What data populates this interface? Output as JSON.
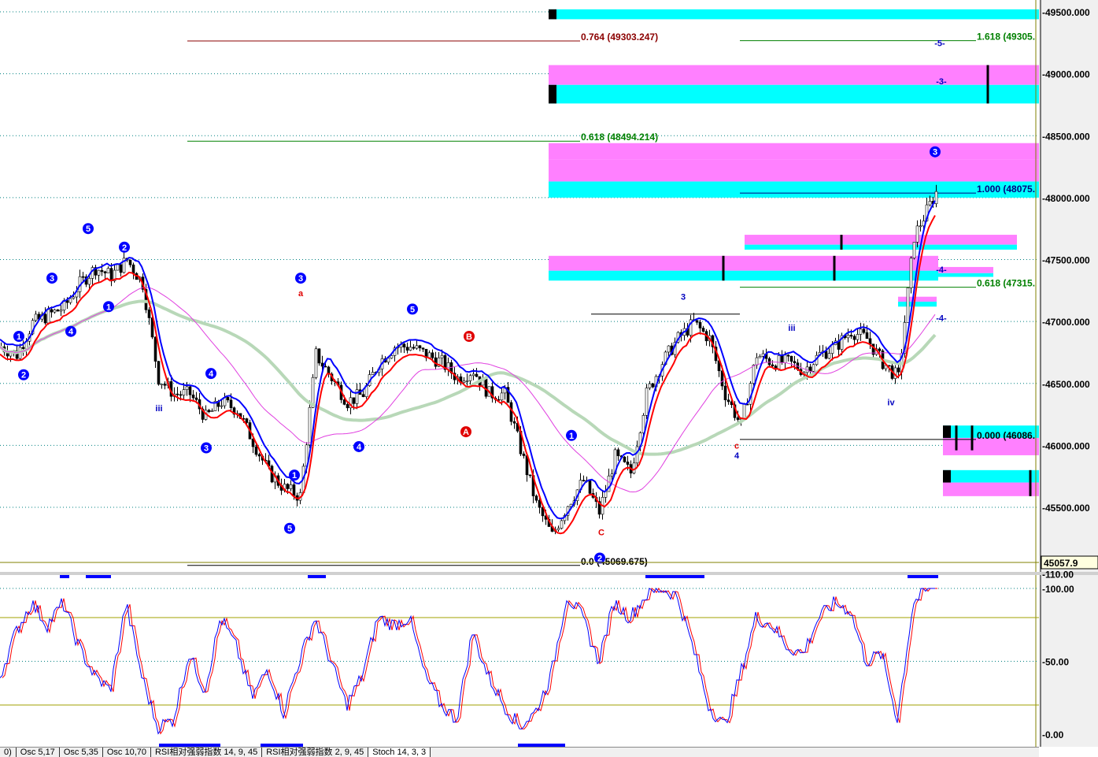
{
  "chart_data": {
    "type": "candlestick",
    "title": "",
    "price_axis": {
      "ticks": [
        "49500.000",
        "49000.000",
        "48500.000",
        "48000.000",
        "47500.000",
        "47000.000",
        "46500.000",
        "46000.000",
        "45500.000"
      ],
      "tick_values": [
        49500,
        49000,
        48500,
        48000,
        47500,
        47000,
        46500,
        46000,
        45500
      ],
      "ylim": [
        45010,
        49600
      ],
      "last_price": "45057.9"
    },
    "close_path": [
      46797,
      46733,
      46988,
      47051,
      47115,
      47306,
      47433,
      47369,
      47497,
      47306,
      46543,
      46415,
      46415,
      46225,
      46352,
      46288,
      46034,
      45779,
      45652,
      45589,
      46733,
      46543,
      46352,
      46415,
      46670,
      46797,
      46797,
      46733,
      46670,
      46543,
      46606,
      46415,
      46415,
      45970,
      45525,
      45271,
      45525,
      45716,
      45461,
      45907,
      45779,
      46415,
      46670,
      46861,
      46988,
      46861,
      46415,
      46161,
      46733,
      46670,
      46670,
      46606,
      46733,
      46797,
      46924,
      46861,
      46670,
      46543,
      47688,
      47942
    ],
    "fib_labels": [
      {
        "text": "0.764 (49303.247)",
        "price": 49303,
        "color": "#8b0000"
      },
      {
        "text": "0.618 (48494.214)",
        "price": 48494,
        "color": "#008000"
      },
      {
        "text": "0.0 (45069.675)",
        "price": 45069,
        "color": "#000000"
      },
      {
        "text": "1.618 (49305.",
        "price": 49305,
        "color": "#008000"
      },
      {
        "text": "1.000 (48075.",
        "price": 48075,
        "color": "#000080"
      },
      {
        "text": "0.618 (47315.",
        "price": 47315,
        "color": "#008000"
      },
      {
        "text": "0.000 (46086.",
        "price": 46086,
        "color": "#000000"
      }
    ],
    "wave_labels": [
      {
        "t": "5",
        "i": 5.6,
        "p": 47750,
        "c": "blue",
        "circ": true
      },
      {
        "t": "2",
        "i": 7.9,
        "p": 47600,
        "c": "blue",
        "circ": true
      },
      {
        "t": "3",
        "i": 3.3,
        "p": 47350,
        "c": "blue",
        "circ": true
      },
      {
        "t": "1",
        "i": 1.2,
        "p": 46880,
        "c": "blue",
        "circ": true
      },
      {
        "t": "4",
        "i": 4.5,
        "p": 46920,
        "c": "blue",
        "circ": true
      },
      {
        "t": "1",
        "i": 6.9,
        "p": 47120,
        "c": "blue",
        "circ": true
      },
      {
        "t": "2",
        "i": 1.5,
        "p": 46570,
        "c": "blue",
        "circ": true
      },
      {
        "t": "4",
        "i": 13.4,
        "p": 46580,
        "c": "blue",
        "circ": true
      },
      {
        "t": "3",
        "i": 13.1,
        "p": 45980,
        "c": "blue",
        "circ": true
      },
      {
        "t": "3",
        "i": 19.1,
        "p": 47350,
        "c": "blue",
        "circ": true
      },
      {
        "t": "1",
        "i": 18.7,
        "p": 45760,
        "c": "blue",
        "circ": true
      },
      {
        "t": "5",
        "i": 18.4,
        "p": 45330,
        "c": "blue",
        "circ": true
      },
      {
        "t": "5",
        "i": 26.2,
        "p": 47100,
        "c": "blue",
        "circ": true
      },
      {
        "t": "4",
        "i": 22.8,
        "p": 45990,
        "c": "blue",
        "circ": true
      },
      {
        "t": "B",
        "i": 29.8,
        "p": 46880,
        "c": "red",
        "circ": true
      },
      {
        "t": "A",
        "i": 29.6,
        "p": 46110,
        "c": "red",
        "circ": true
      },
      {
        "t": "1",
        "i": 36.3,
        "p": 46080,
        "c": "blue",
        "circ": true
      },
      {
        "t": "2",
        "i": 38.1,
        "p": 45090,
        "c": "blue",
        "circ": true
      },
      {
        "t": "3",
        "i": 59.4,
        "p": 48370,
        "c": "blue",
        "circ": true
      },
      {
        "t": "a",
        "i": 19.1,
        "p": 47230,
        "c": "red"
      },
      {
        "t": "iii",
        "i": 10.1,
        "p": 46300,
        "c": "blue"
      },
      {
        "t": "3",
        "i": 43.4,
        "p": 47200,
        "c": "blue"
      },
      {
        "t": "iii",
        "i": 50.3,
        "p": 46950,
        "c": "blue"
      },
      {
        "t": "iv",
        "i": 56.6,
        "p": 46350,
        "c": "blue"
      },
      {
        "t": "c",
        "i": 46.8,
        "p": 46000,
        "c": "red"
      },
      {
        "t": "4",
        "i": 46.8,
        "p": 45920,
        "c": "blue"
      },
      {
        "t": "C",
        "i": 38.2,
        "p": 45300,
        "c": "red"
      },
      {
        "t": "-5-",
        "i": 59.7,
        "p": 49250,
        "c": "blue"
      },
      {
        "t": "-3-",
        "i": 59.8,
        "p": 48940,
        "c": "blue"
      },
      {
        "t": "-4-",
        "i": 59.8,
        "p": 47420,
        "c": "blue"
      },
      {
        "t": "-4-",
        "i": 59.8,
        "p": 47030,
        "c": "blue"
      }
    ],
    "oscillator": {
      "name": "Stoch 14, 3, 3",
      "ticks": [
        "110.00",
        "100.00",
        "50.00",
        "0.00"
      ],
      "tick_values": [
        110,
        100,
        50,
        0
      ],
      "ylim": [
        -8,
        110
      ],
      "levels": [
        80,
        20
      ],
      "k": [
        40,
        70,
        90,
        75,
        90,
        60,
        40,
        30,
        90,
        40,
        5,
        10,
        55,
        30,
        80,
        60,
        25,
        45,
        15,
        50,
        80,
        50,
        20,
        40,
        80,
        75,
        80,
        40,
        20,
        10,
        70,
        40,
        20,
        5,
        15,
        40,
        95,
        80,
        50,
        90,
        80,
        95,
        100,
        95,
        60,
        20,
        5,
        40,
        80,
        75,
        60,
        55,
        80,
        90,
        85,
        50,
        55,
        10,
        90,
        100
      ]
    },
    "colors": {
      "cyan": "#00ffff",
      "pink": "#ff80ff",
      "up_ma": "#0000ff",
      "dn_ma": "#ff0000",
      "ma_long": "#b8d8b8",
      "ma_mid": "#e040e0"
    }
  },
  "tabs": [
    "0)",
    "Osc 5,17",
    "Osc 5,35",
    "Osc 10,70",
    "RSI相对强弱指数 14, 9, 45",
    "RSI相对强弱指数 2, 9, 45",
    "Stoch 14, 3, 3"
  ]
}
